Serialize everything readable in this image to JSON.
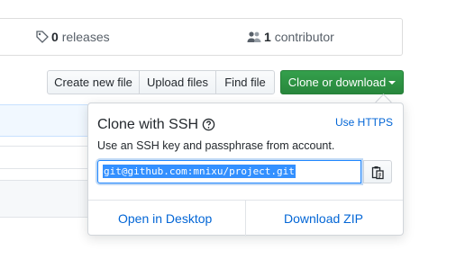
{
  "stats": {
    "releases_count": "0",
    "releases_label": "releases",
    "contributors_count": "1",
    "contributors_label": "contributor"
  },
  "toolbar": {
    "create_file": "Create new file",
    "upload_files": "Upload files",
    "find_file": "Find file",
    "clone_download": "Clone or download"
  },
  "clone_panel": {
    "title": "Clone with SSH",
    "use_https": "Use HTTPS",
    "description": "Use an SSH key and passphrase from account.",
    "url": "git@github.com:mnixu/project.git",
    "open_desktop": "Open in Desktop",
    "download_zip": "Download ZIP"
  },
  "colors": {
    "primary_green": "#2ea44f",
    "link_blue": "#0366d6",
    "selection_blue": "#3390ff"
  }
}
